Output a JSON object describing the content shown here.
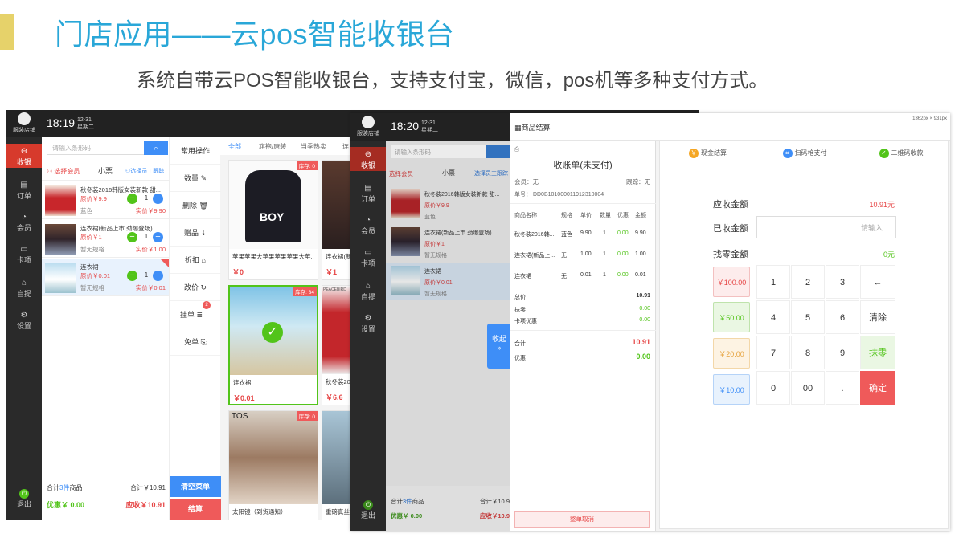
{
  "slide": {
    "title": "门店应用——云pos智能收银台",
    "subtitle": "系统自带云POS智能收银台，支持支付宝，微信，pos机等多种支付方式。"
  },
  "screen1": {
    "store_name": "服装店铺",
    "time": "18:19",
    "date_line1": "12-31",
    "date_line2": "星期二",
    "nav": [
      {
        "label": "收银",
        "icon": "cart-icon"
      },
      {
        "label": "订单",
        "icon": "document-icon"
      },
      {
        "label": "会员",
        "icon": "user-icon"
      },
      {
        "label": "卡项",
        "icon": "card-icon"
      },
      {
        "label": "自提",
        "icon": "store-icon"
      },
      {
        "label": "设置",
        "icon": "gear-icon"
      }
    ],
    "exit_label": "退出",
    "search_placeholder": "请输入条形码",
    "select_member": "选择会员",
    "ticket": "小票",
    "select_staff": "选择员工跟踪",
    "cart_items": [
      {
        "name": "秋冬装2016韩版女装新款 甜...",
        "orig": "原价￥9.9",
        "spec": "蓝色",
        "qty": "1",
        "real": "实价￥9.90"
      },
      {
        "name": "连衣裙(新品上市 劲爆登场)",
        "orig": "原价￥1",
        "spec": "暂无规格",
        "qty": "1",
        "real": "实价￥1.00"
      },
      {
        "name": "连衣裙",
        "orig": "原价￥0.01",
        "spec": "暂无规格",
        "qty": "1",
        "real": "实价￥0.01"
      }
    ],
    "footer": {
      "total_left_prefix": "合计",
      "total_count": "3件",
      "total_left_suffix": "商品",
      "total_right": "合计￥10.91",
      "discount": "优惠￥ 0.00",
      "due": "应收￥10.91"
    },
    "ops_title": "常用操作",
    "ops": [
      "数量",
      "删除",
      "赠品",
      "折扣",
      "改价",
      "挂单",
      "免单"
    ],
    "hang_badge": "2",
    "clear_btn": "清空菜单",
    "checkout_btn": "结算",
    "tabs": [
      "全部",
      "旗袍/唐装",
      "当季热卖",
      "连"
    ],
    "goods": [
      {
        "name": "苹果苹果大苹果苹果苹果大苹...",
        "price": "￥0",
        "stock": "库存: 0",
        "print": "BOY"
      },
      {
        "name": "连衣裙(新",
        "price": "￥1",
        "stock": "",
        "print": ""
      },
      {
        "name": "连衣裙",
        "price": "￥0.01",
        "stock": "库存: 34",
        "print": ""
      },
      {
        "name": "秋冬装201",
        "price": "￥6.6",
        "stock": "",
        "print": "PEACEBIRD"
      },
      {
        "name": "太阳镜（到货通知）",
        "price": "",
        "stock": "库存: 0",
        "print": "TOS"
      },
      {
        "name": "重磅真丝",
        "price": "",
        "stock": "",
        "print": ""
      }
    ]
  },
  "screen2": {
    "store_name": "服装店铺",
    "time": "18:20",
    "date_line1": "12-31",
    "date_line2": "星期二",
    "size_note": "1362px × 931px",
    "panel_title": "商品结算",
    "receipt": {
      "title": "收账单(未支付)",
      "member": "会员：无",
      "follow": "跟踪：无",
      "order_no": "单号： DD0B101000011912310004",
      "headers": [
        "商品名称",
        "规格",
        "单价",
        "数量",
        "优惠",
        "金额"
      ],
      "rows": [
        [
          "秋冬装2016韩...",
          "蓝色",
          "9.90",
          "1",
          "0.00",
          "9.90"
        ],
        [
          "连衣裙(新品上...",
          "无",
          "1.00",
          "1",
          "0.00",
          "1.00"
        ],
        [
          "连衣裙",
          "无",
          "0.01",
          "1",
          "0.00",
          "0.01"
        ]
      ],
      "total_label": "总价",
      "total": "10.91",
      "round_label": "抹零",
      "round": "0.00",
      "card_label": "卡项优惠",
      "card": "0.00",
      "sum_label": "合计",
      "sum": "10.91",
      "disc_label": "优惠",
      "disc": "0.00",
      "cancel": "整单取消"
    },
    "collapse": "收起",
    "pay_tabs": [
      "现金结算",
      "扫码枪支付",
      "二维码收款"
    ],
    "due_label": "应收金额",
    "due": "10.91元",
    "received_label": "已收金额",
    "received_placeholder": "请输入",
    "change_label": "找零金额",
    "change": "0元",
    "quick": [
      "￥100.00",
      "￥50.00",
      "￥20.00",
      "￥10.00"
    ],
    "keys": [
      "1",
      "2",
      "3",
      "←",
      "4",
      "5",
      "6",
      "清除",
      "7",
      "8",
      "9",
      "抹零",
      "0",
      "00",
      ".",
      "确定"
    ],
    "cart_footer": {
      "total_left_prefix": "合计",
      "total_count": "3件",
      "total_left_suffix": "商品",
      "total_right": "合计￥10.9",
      "discount": "优惠￥ 0.00",
      "due": "应收￥10.9"
    },
    "exit_label": "退出"
  },
  "colors": {
    "title": "#29a7d8",
    "accent": "#e6d26a",
    "primary": "#3e8ef7",
    "danger": "#ef5a5a",
    "success": "#52c41a"
  }
}
